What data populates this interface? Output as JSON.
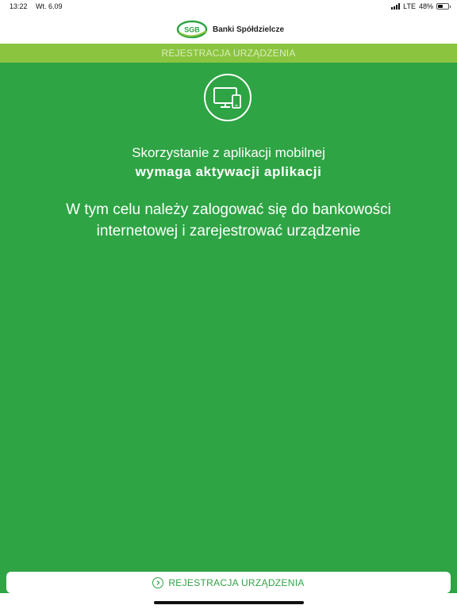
{
  "status_bar": {
    "time": "13:22",
    "date": "Wt. 6.09",
    "network": "LTE",
    "battery": "48%",
    "battery_level": 0.48
  },
  "header": {
    "logo_mark": "SGB",
    "brand_name": "Banki Spółdzielcze"
  },
  "section_bar": {
    "title": "REJESTRACJA URZĄDZENIA"
  },
  "main": {
    "icon": "devices-icon",
    "line1": "Skorzystanie z aplikacji mobilnej",
    "line2": "wymaga aktywacji aplikacji",
    "message_line1": "W tym celu należy zalogować się do bankowości",
    "message_line2": "internetowej i zarejestrować urządzenie"
  },
  "footer": {
    "button_label": "REJESTRACJA URZĄDZENIA",
    "button_icon": "chevron-right-icon"
  },
  "colors": {
    "primary_green": "#2ea444",
    "light_green": "#8bc43f",
    "white": "#ffffff"
  }
}
